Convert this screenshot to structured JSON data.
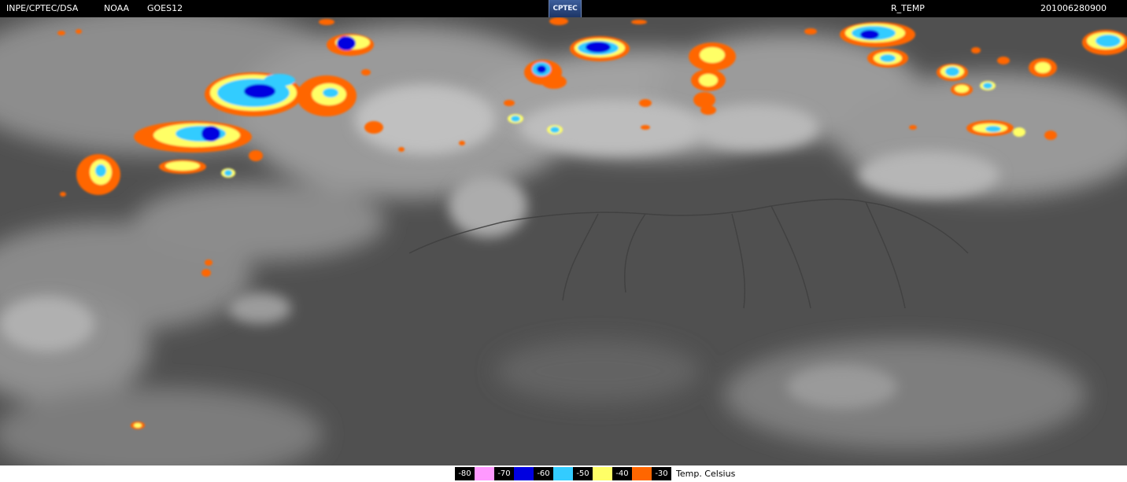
{
  "header": {
    "source": "INPE/CPTEC/DSA",
    "agency": "NOAA",
    "satellite": "GOES12",
    "logo_text": "CPTEC",
    "product": "R_TEMP",
    "datetime": "201006280900"
  },
  "legend": {
    "entries": [
      {
        "label": "-80",
        "color": "#ff99ff"
      },
      {
        "label": "-70",
        "color": "#0000e0"
      },
      {
        "label": "-60",
        "color": "#33ccff"
      },
      {
        "label": "-50",
        "color": "#ffff66"
      },
      {
        "label": "-40",
        "color": "#ff6600"
      },
      {
        "label": "-30",
        "color": "#000000"
      }
    ],
    "unit": "Temp. Celsius"
  },
  "colors": {
    "background_gray": "#4e4e4e",
    "cloud_gray": "#b4b4b4",
    "river_gray": "#3a3a3a",
    "orange": "#ff6600",
    "yellow": "#ffff66",
    "cyan": "#33ccff",
    "blue": "#0000e0"
  }
}
